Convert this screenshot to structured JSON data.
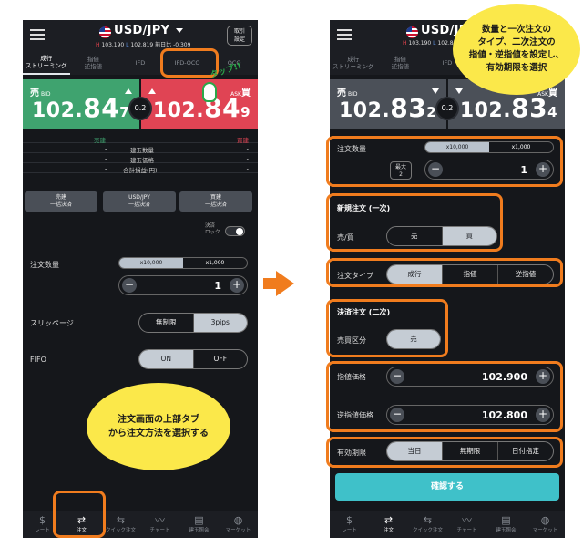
{
  "header": {
    "pair": "USD/JPY",
    "high_prefix": "H",
    "high": "103.190",
    "low_prefix": "L",
    "low": "102.819",
    "prev_day": "前日比 -0.309",
    "cancel_settings": "取引\n設定"
  },
  "tabs": [
    "成行\nストリーミング",
    "指値\n逆指値",
    "IFD",
    "IFD-OCO",
    "OCO"
  ],
  "left": {
    "sell": {
      "label": "売",
      "sub": "BID",
      "head": "102.",
      "big": "84",
      "tail": "7"
    },
    "buy": {
      "label": "買",
      "sub": "ASK",
      "head": "102.",
      "big": "84",
      "tail": "9"
    },
    "spread": "0.2",
    "table_header": {
      "sell": "売建",
      "buy": "買建"
    },
    "table_rows": [
      {
        "label": "建玉数量",
        "sell": "-",
        "buy": "-"
      },
      {
        "label": "建玉価格",
        "sell": "-",
        "buy": "-"
      },
      {
        "label": "合計損益(円)",
        "sell": "-",
        "buy": "-"
      }
    ],
    "bulk_buttons": [
      "売建\n一括決済",
      "USD/JPY\n一括決済",
      "買建\n一括決済"
    ],
    "settle_lock": "決済\nロック",
    "qty_label": "注文数量",
    "unit_options": [
      "x10,000",
      "x1,000"
    ],
    "qty_value": "1",
    "slippage_label": "スリッページ",
    "slippage_options": [
      "無制限",
      "3pips"
    ],
    "fifo_label": "FIFO",
    "fifo_options": [
      "ON",
      "OFF"
    ],
    "tap_text": "タップ!!"
  },
  "right": {
    "sell": {
      "label": "売",
      "sub": "BID",
      "head": "102.",
      "big": "83",
      "tail": "2"
    },
    "buy": {
      "label": "買",
      "sub": "ASK",
      "head": "102.",
      "big": "83",
      "tail": "4"
    },
    "spread": "0.2",
    "qty_label": "注文数量",
    "unit_options": [
      "x10,000",
      "x1,000"
    ],
    "max_label": "最大\n2",
    "qty_value": "1",
    "new_order_title": "新規注文 (一次)",
    "side_label": "売/買",
    "side_options": [
      "売",
      "買"
    ],
    "order_type_label": "注文タイプ",
    "order_type_options": [
      "成行",
      "指値",
      "逆指値"
    ],
    "settle_title": "決済注文 (二次)",
    "settle_side_label": "売買区分",
    "settle_side_value": "売",
    "limit_label": "指値価格",
    "limit_value": "102.900",
    "stop_label": "逆指値価格",
    "stop_value": "102.800",
    "expiry_label": "有効期限",
    "expiry_options": [
      "当日",
      "無期限",
      "日付指定"
    ],
    "confirm": "確認する"
  },
  "tabbar": [
    {
      "icon": "$",
      "label": "レート"
    },
    {
      "icon": "⇄",
      "label": "注文"
    },
    {
      "icon": "⇆",
      "label": "クイック注文"
    },
    {
      "icon": "〰",
      "label": "チャート"
    },
    {
      "icon": "▤",
      "label": "建玉照会"
    },
    {
      "icon": "◍",
      "label": "マーケット"
    }
  ],
  "callouts": {
    "left": "注文画面の上部タブ\nから注文方法を選択する",
    "right": "数量と一次注文の\nタイプ、二次注文の\n指値・逆指値を設定し、\n有効期限を選択"
  },
  "colors": {
    "sell_tile": "#3fa36f",
    "buy_tile": "#e04454",
    "highlight": "#f07c1e",
    "callout": "#fbe84a",
    "confirm": "#3fc1c9"
  }
}
